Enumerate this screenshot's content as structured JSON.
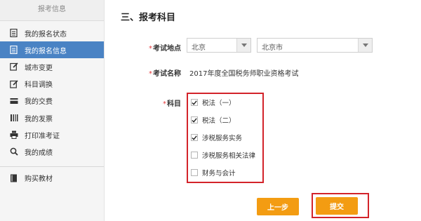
{
  "sidebar": {
    "header": "报考信息",
    "items": [
      {
        "label": "我的报名状态",
        "icon": "document-icon"
      },
      {
        "label": "我的报名信息",
        "icon": "document-icon",
        "active": true
      },
      {
        "label": "城市变更",
        "icon": "edit-icon"
      },
      {
        "label": "科目调换",
        "icon": "edit-icon"
      },
      {
        "label": "我的交费",
        "icon": "card-icon"
      },
      {
        "label": "我的发票",
        "icon": "invoice-icon"
      },
      {
        "label": "打印准考证",
        "icon": "printer-icon"
      },
      {
        "label": "我的成绩",
        "icon": "search-icon"
      }
    ],
    "buy": {
      "label": "购买教材",
      "icon": "book-icon"
    }
  },
  "main": {
    "section_title": "三、报考科目",
    "location": {
      "required_mark": "*",
      "label": "考试地点",
      "province": "北京",
      "city": "北京市"
    },
    "exam_name": {
      "label": "考试名称",
      "value": "2017年度全国税务师职业资格考试"
    },
    "subjects": {
      "required_mark": "*",
      "label": "科目",
      "items": [
        {
          "label": "税法（一）",
          "checked": true
        },
        {
          "label": "税法（二）",
          "checked": true
        },
        {
          "label": "涉税服务实务",
          "checked": true
        },
        {
          "label": "涉税服务相关法律",
          "checked": false
        },
        {
          "label": "财务与会计",
          "checked": false
        }
      ]
    },
    "buttons": {
      "prev": "上一步",
      "submit": "提交"
    }
  },
  "colors": {
    "accent_blue": "#4a83c4",
    "button_orange": "#f39c12",
    "highlight_red": "#d3232a"
  }
}
